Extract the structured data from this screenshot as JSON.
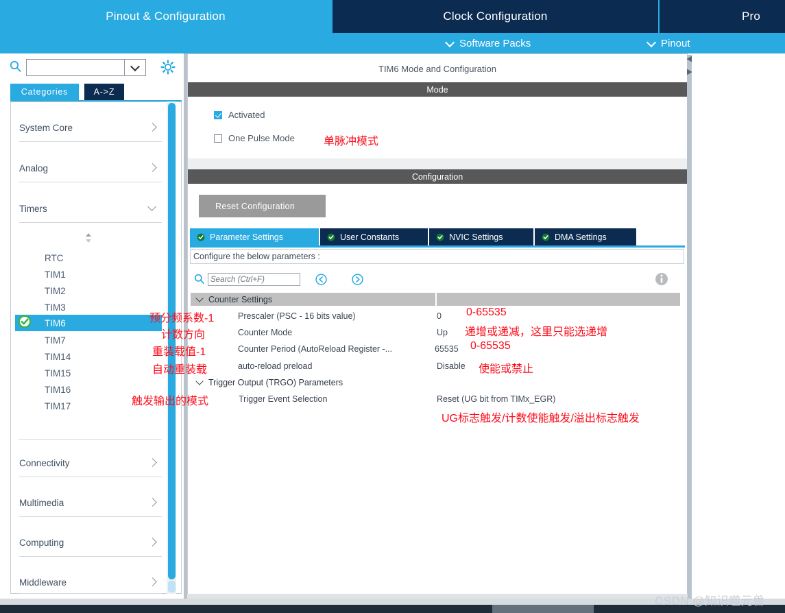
{
  "top_tabs": [
    {
      "label": "Pinout & Configuration",
      "active": true
    },
    {
      "label": "Clock Configuration",
      "active": false
    },
    {
      "label": "Pro",
      "active": false
    }
  ],
  "sub_toolbar": {
    "software_packs": "Software Packs",
    "pinout": "Pinout"
  },
  "sidebar": {
    "search_value": "",
    "search_placeholder": "",
    "tabs": [
      {
        "label": "Categories",
        "active": true
      },
      {
        "label": "A->Z",
        "active": false
      }
    ],
    "categories": [
      {
        "label": "System Core",
        "state": "collapsed"
      },
      {
        "label": "Analog",
        "state": "collapsed"
      },
      {
        "label": "Timers",
        "state": "expanded"
      },
      {
        "label": "Connectivity",
        "state": "collapsed"
      },
      {
        "label": "Multimedia",
        "state": "collapsed"
      },
      {
        "label": "Computing",
        "state": "collapsed"
      },
      {
        "label": "Middleware",
        "state": "collapsed"
      }
    ],
    "timers": [
      {
        "label": "RTC",
        "selected": false
      },
      {
        "label": "TIM1",
        "selected": false
      },
      {
        "label": "TIM2",
        "selected": false
      },
      {
        "label": "TIM3",
        "selected": false
      },
      {
        "label": "TIM6",
        "selected": true
      },
      {
        "label": "TIM7",
        "selected": false
      },
      {
        "label": "TIM14",
        "selected": false
      },
      {
        "label": "TIM15",
        "selected": false
      },
      {
        "label": "TIM16",
        "selected": false
      },
      {
        "label": "TIM17",
        "selected": false
      }
    ]
  },
  "main": {
    "title": "TIM6 Mode and Configuration",
    "mode": {
      "header": "Mode",
      "activated_label": "Activated",
      "activated_checked": true,
      "one_pulse_label": "One Pulse Mode",
      "one_pulse_checked": false
    },
    "configuration": {
      "header": "Configuration",
      "reset_button": "Reset Configuration",
      "tabs": [
        {
          "label": "Parameter Settings",
          "active": true
        },
        {
          "label": "User Constants",
          "active": false
        },
        {
          "label": "NVIC Settings",
          "active": false
        },
        {
          "label": "DMA Settings",
          "active": false
        }
      ],
      "configure_hint": "Configure the below parameters :",
      "search_value": "",
      "search_placeholder": "Search (Ctrl+F)",
      "groups": [
        {
          "name": "Counter Settings",
          "rows": [
            {
              "name": "Prescaler (PSC - 16 bits value)",
              "value": "0"
            },
            {
              "name": "Counter Mode",
              "value": "Up"
            },
            {
              "name": "Counter Period (AutoReload Register -...",
              "value": "65535"
            },
            {
              "name": "auto-reload preload",
              "value": "Disable"
            }
          ]
        },
        {
          "name": "Trigger Output (TRGO) Parameters",
          "rows": [
            {
              "name": "Trigger Event Selection",
              "value": "Reset (UG bit from TIMx_EGR)"
            }
          ]
        }
      ]
    }
  },
  "annotations": {
    "color": "#fc0d1b",
    "one_pulse": "单脉冲模式",
    "prescaler_left": "预分频系数-1",
    "prescaler_right": "0-65535",
    "counter_mode_left": "计数方向",
    "counter_mode_right": "递增或递减，这里只能选递增",
    "counter_period_left": "重装载值-1",
    "counter_period_right": "0-65535",
    "autoreload_left": "自动重装载",
    "autoreload_right": "使能或禁止",
    "trigger_left": "触发输出的模式",
    "trigger_bottom": "UG标志触发/计数使能触发/溢出标志触发"
  },
  "watermark": "CSDN @知识噬元兽",
  "colors": {
    "accent": "#29aae1",
    "dark_navy": "#0b2b50",
    "section_header": "#585858",
    "annotation_red": "#fc0d1b",
    "group_header": "#c0c0c0"
  }
}
